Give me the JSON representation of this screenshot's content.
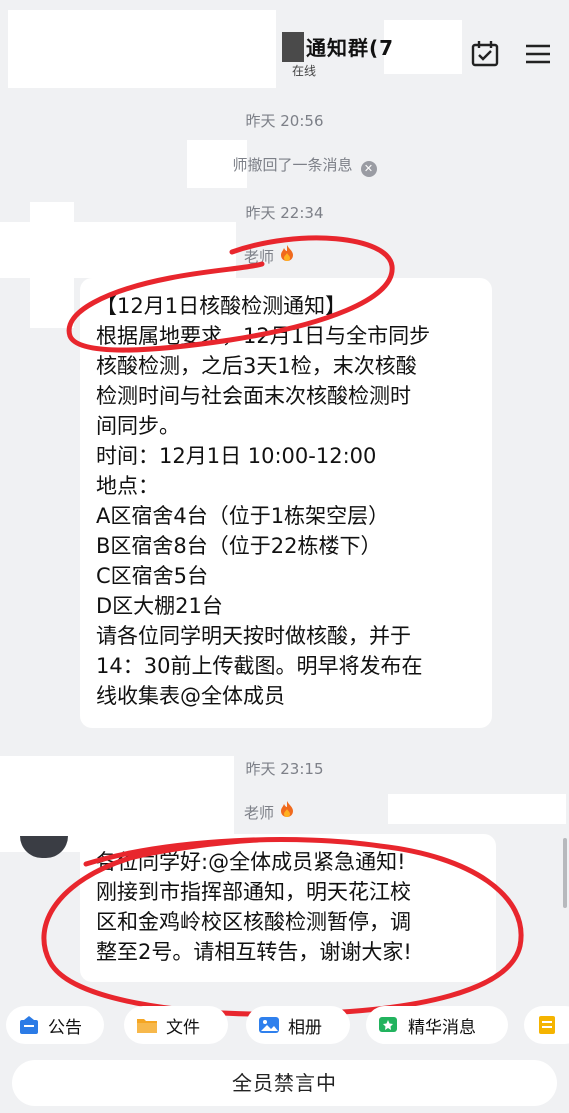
{
  "header": {
    "title": "通知群(7",
    "subtitle": "在线",
    "calendar_icon": "calendar-check-icon",
    "menu_icon": "menu-icon"
  },
  "messages": [
    {
      "type": "time",
      "text": "昨天 20:56"
    },
    {
      "type": "system",
      "text": "师撤回了一条消息",
      "icon": "close-circle-icon"
    },
    {
      "type": "time",
      "text": "昨天 22:34"
    },
    {
      "type": "message",
      "sender": "老师",
      "lines": [
        "【12月1日核酸检测通知】",
        "根据属地要求，12月1日与全市同步",
        "核酸检测，之后3天1检，末次核酸",
        "检测时间与社会面末次核酸检测时",
        "间同步。",
        "时间：12月1日 10:00-12:00",
        "地点：",
        "A区宿舍4台（位于1栋架空层）",
        "B区宿舍8台（位于22栋楼下）",
        "C区宿舍5台",
        "D区大棚21台",
        "请各位同学明天按时做核酸，并于",
        "14：30前上传截图。明早将发布在",
        "线收集表@全体成员"
      ]
    },
    {
      "type": "time",
      "text": "昨天 23:15"
    },
    {
      "type": "message",
      "sender": "老师",
      "lines": [
        "各位同学好:@全体成员紧急通知!",
        "刚接到市指挥部通知，明天花江校",
        "区和金鸡岭校区核酸检测暂停，调",
        "整至2号。请相互转告，谢谢大家!"
      ]
    }
  ],
  "toolbar": [
    {
      "label": "公告",
      "icon": "announcement-icon",
      "color": "#2b7be6"
    },
    {
      "label": "文件",
      "icon": "folder-icon",
      "color": "#f5a623"
    },
    {
      "label": "相册",
      "icon": "photo-album-icon",
      "color": "#2f80ed"
    },
    {
      "label": "精华消息",
      "icon": "essence-message-icon",
      "color": "#22b35e"
    },
    {
      "label": "",
      "icon": "notes-icon",
      "color": "#f5b400"
    }
  ],
  "input": {
    "muted_text": "全员禁言中"
  },
  "annotation_color": "#e8262d"
}
